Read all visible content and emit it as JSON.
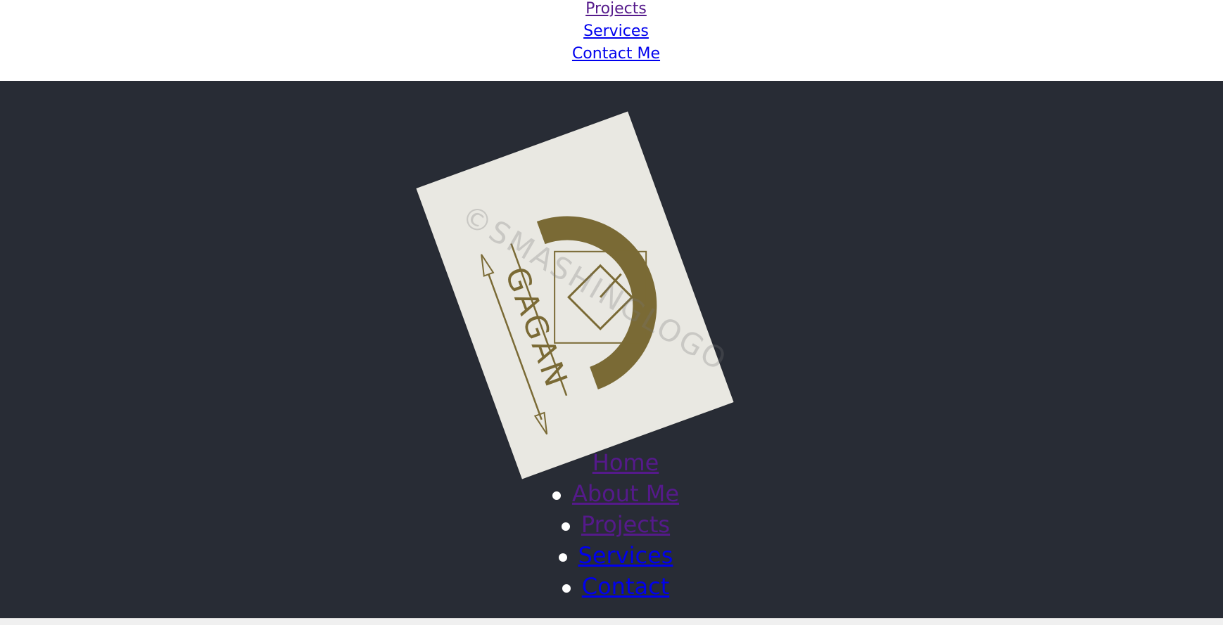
{
  "top_nav": {
    "links": [
      {
        "label": "Projects",
        "visited": true
      },
      {
        "label": "Services",
        "visited": false
      },
      {
        "label": "Contact Me",
        "visited": false
      }
    ]
  },
  "footer": {
    "logo": {
      "text": "GAGAN",
      "watermark": "©SMASHINGLOGO",
      "brand_color": "#7a6a35",
      "card_color": "#e9e8e2"
    },
    "links": [
      {
        "label": "Home",
        "visited": true
      },
      {
        "label": "About Me",
        "visited": true
      },
      {
        "label": "Projects",
        "visited": true
      },
      {
        "label": "Services",
        "visited": false
      },
      {
        "label": "Contact",
        "visited": false
      }
    ]
  },
  "colors": {
    "footer_bg": "#282c35",
    "link_unvisited": "#0000ee",
    "link_visited": "#551a8b"
  }
}
